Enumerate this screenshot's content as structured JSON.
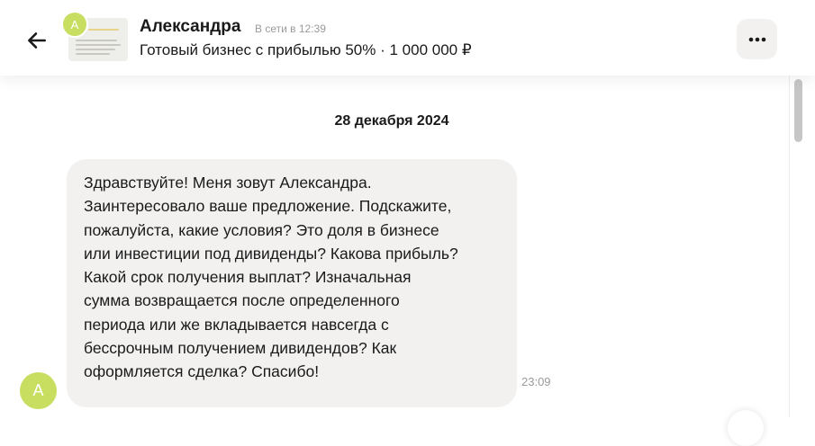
{
  "header": {
    "back_icon": "arrow-left-icon",
    "avatar_letter": "А",
    "contact_name": "Александра",
    "status": "В сети в 12:39",
    "listing_title": "Готовый бизнес с прибылью 50% · 1 000 000 ₽",
    "more_icon": "more-horizontal-icon"
  },
  "chat": {
    "date_separator": "28 декабря 2024",
    "messages": [
      {
        "avatar_letter": "А",
        "text": "Здравствуйте! Меня зовут Александра.\nЗаинтересовало ваше предложение. Подскажите,\nпожалуйста, какие условия? Это доля в бизнесе\nили инвестиции под дивиденды? Какова прибыль?\nКакой срок получения выплат? Изначальная\nсумма возвращается после определенного\nпериода или же вкладывается навсегда с\nбессрочным получением дивидендов? Как\nоформляется сделка? Спасибо!",
        "time": "23:09"
      }
    ]
  },
  "colors": {
    "avatar": "#c8de60",
    "bubble": "#f2f1f0",
    "muted_text": "#9a9a9a"
  }
}
